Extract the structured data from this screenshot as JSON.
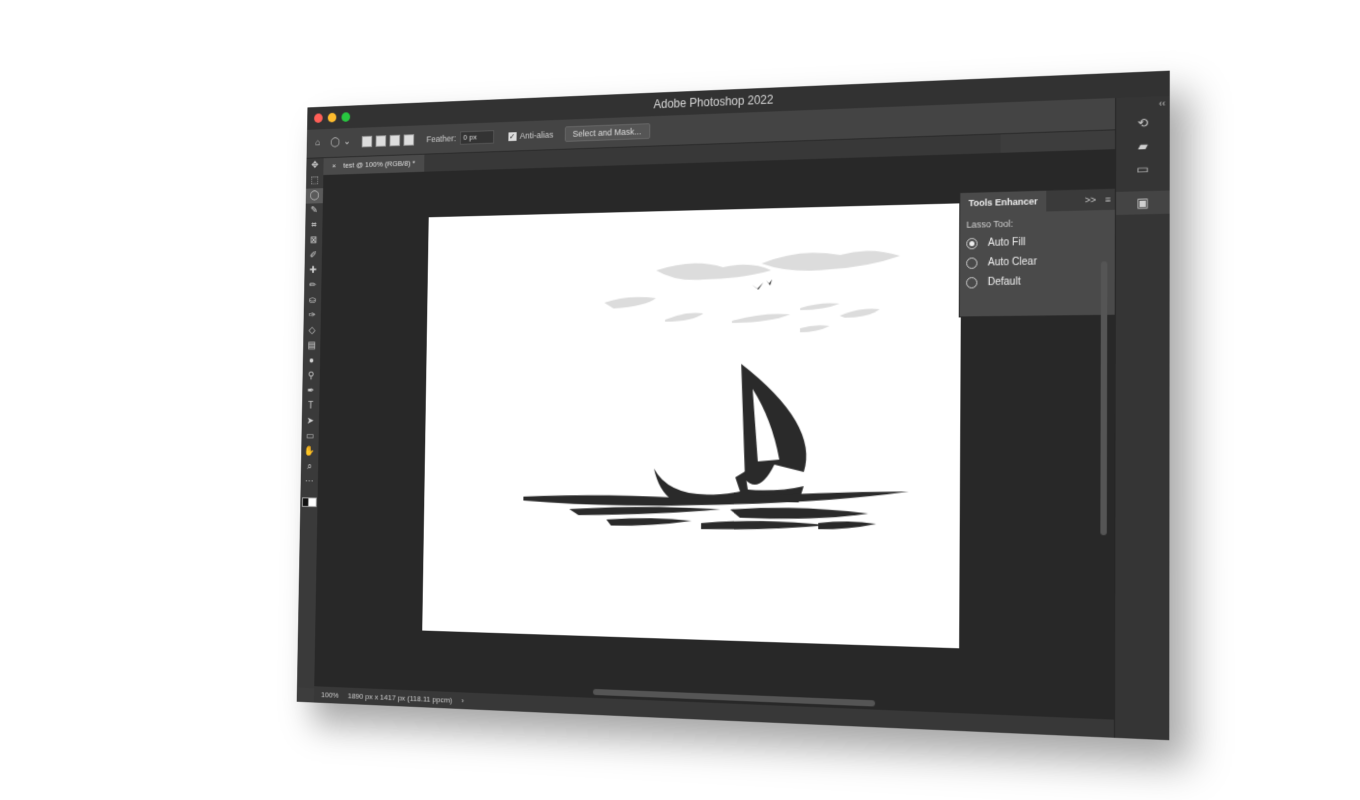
{
  "window": {
    "title": "Adobe Photoshop 2022"
  },
  "traffic_lights": [
    "#ff5f57",
    "#febc2e",
    "#28c840"
  ],
  "options_bar": {
    "feather_label": "Feather:",
    "feather_value": "0 px",
    "antialias_label": "Anti-alias",
    "antialias_checked": true,
    "select_mask_label": "Select and Mask..."
  },
  "document_tab": {
    "label": "test @ 100% (RGB/8) *",
    "close": "×"
  },
  "tools": [
    "move-tool",
    "marquee-tool",
    "lasso-tool",
    "quick-select-tool",
    "crop-tool",
    "frame-tool",
    "eyedropper-tool",
    "healing-brush-tool",
    "brush-tool",
    "clone-stamp-tool",
    "history-brush-tool",
    "eraser-tool",
    "gradient-tool",
    "blur-tool",
    "dodge-tool",
    "pen-tool",
    "type-tool",
    "path-select-tool",
    "rectangle-tool",
    "hand-tool",
    "zoom-tool",
    "more-tools"
  ],
  "tool_glyphs": [
    "✥",
    "⬚",
    "◯",
    "✎",
    "⌗",
    "⊠",
    "✐",
    "✚",
    "✏",
    "⛀",
    "✑",
    "◇",
    "▤",
    "●",
    "⚲",
    "✒",
    "T",
    "➤",
    "▭",
    "✋",
    "⌕",
    "⋯"
  ],
  "active_tool_index": 2,
  "panel": {
    "tab_label": "Tools Enhancer",
    "collapse": ">>",
    "menu": "≡",
    "section_label": "Lasso Tool:",
    "options": [
      {
        "label": "Auto Fill",
        "selected": true
      },
      {
        "label": "Auto Clear",
        "selected": false
      },
      {
        "label": "Default",
        "selected": false
      }
    ]
  },
  "status_bar": {
    "zoom": "100%",
    "doc_info": "1890 px x 1417 px (118.11 ppcm)",
    "arrow": "›"
  },
  "right_dock": [
    "history-icon",
    "layers-comp-icon",
    "comment-icon",
    "image-icon"
  ],
  "right_dock_collapse": "‹‹"
}
